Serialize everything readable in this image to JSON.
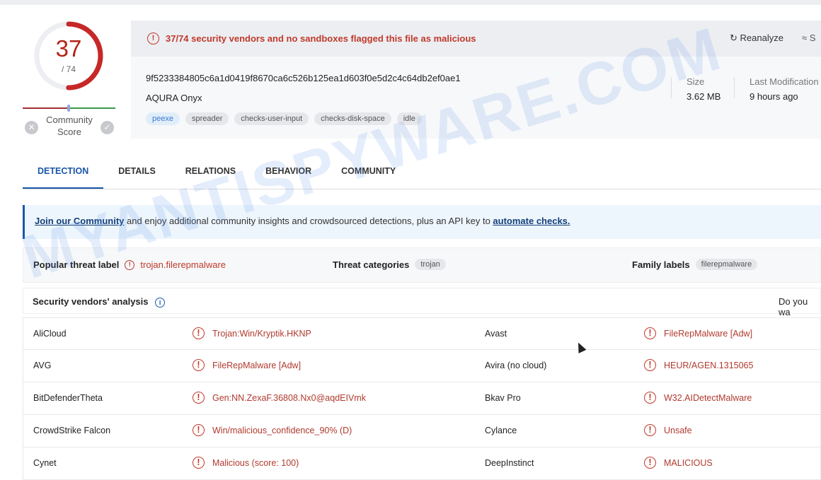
{
  "score": {
    "detected": "37",
    "total": "/ 74",
    "fraction": 0.5,
    "community_label": "Community Score"
  },
  "banner": {
    "warning": "37/74 security vendors and no sandboxes flagged this file as malicious",
    "reanalyze": "Reanalyze",
    "similar": "S"
  },
  "file": {
    "hash": "9f5233384805c6a1d0419f8670ca6c526b125ea1d603f0e5d2c4c64db2ef0ae1",
    "name": "AQURA Onyx",
    "tags": [
      "peexe",
      "spreader",
      "checks-user-input",
      "checks-disk-space",
      "idle"
    ],
    "size_label": "Size",
    "size": "3.62 MB",
    "mod_label": "Last Modification",
    "mod": "9 hours ago"
  },
  "tabs": [
    "DETECTION",
    "DETAILS",
    "RELATIONS",
    "BEHAVIOR",
    "COMMUNITY"
  ],
  "join": {
    "link1": "Join our Community",
    "text": " and enjoy additional community insights and crowdsourced detections, plus an API key to ",
    "link2": "automate checks."
  },
  "labels": {
    "popular_label": "Popular threat label",
    "popular": "trojan.filerepmalware",
    "categories_label": "Threat categories",
    "category": "trojan",
    "family_label": "Family labels",
    "family": "filerepmalware"
  },
  "vendors": {
    "title": "Security vendors' analysis",
    "cta": "Do you wa",
    "rows": [
      {
        "v1": "AliCloud",
        "d1": "Trojan:Win/Kryptik.HKNP",
        "v2": "Avast",
        "d2": "FileRepMalware [Adw]"
      },
      {
        "v1": "AVG",
        "d1": "FileRepMalware [Adw]",
        "v2": "Avira (no cloud)",
        "d2": "HEUR/AGEN.1315065"
      },
      {
        "v1": "BitDefenderTheta",
        "d1": "Gen:NN.ZexaF.36808.Nx0@aqdEIVmk",
        "v2": "Bkav Pro",
        "d2": "W32.AIDetectMalware"
      },
      {
        "v1": "CrowdStrike Falcon",
        "d1": "Win/malicious_confidence_90% (D)",
        "v2": "Cylance",
        "d2": "Unsafe"
      },
      {
        "v1": "Cynet",
        "d1": "Malicious (score: 100)",
        "v2": "DeepInstinct",
        "d2": "MALICIOUS"
      }
    ]
  },
  "watermark": "MYANTISPYWARE.COM",
  "colors": {
    "malicious": "#c0392b",
    "accent": "#1a56a8"
  }
}
